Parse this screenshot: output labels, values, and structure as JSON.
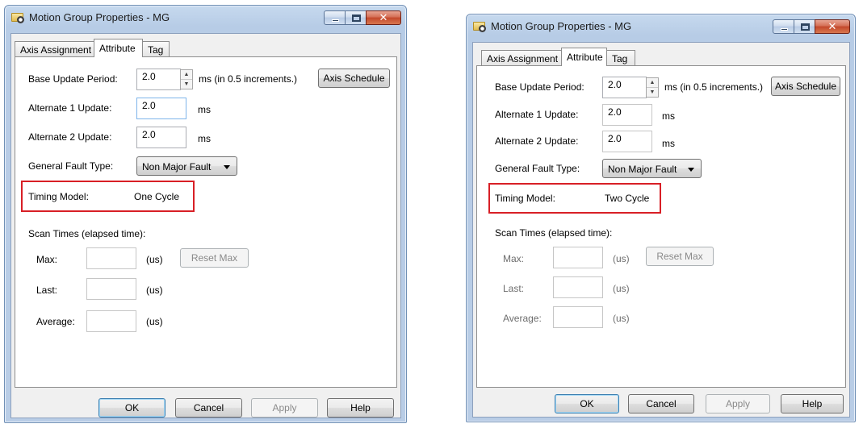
{
  "windows": [
    {
      "title": "Motion Group Properties - MG",
      "tabs": [
        "Axis Assignment",
        "Attribute",
        "Tag"
      ],
      "active_tab": "Attribute",
      "base_update_period": {
        "label": "Base Update Period:",
        "value": "2.0",
        "unit": "ms (in 0.5 increments.)"
      },
      "axis_schedule_button": "Axis Schedule",
      "alternate1": {
        "label": "Alternate 1 Update:",
        "value": "2.0",
        "unit": "ms"
      },
      "alternate2": {
        "label": "Alternate 2 Update:",
        "value": "2.0",
        "unit": "ms"
      },
      "general_fault_type": {
        "label": "General Fault Type:",
        "selected": "Non Major Fault"
      },
      "timing_model": {
        "label": "Timing Model:",
        "value": "One Cycle"
      },
      "scan_times": {
        "heading": "Scan Times (elapsed time):",
        "max": {
          "label": "Max:",
          "value": "",
          "unit": "(us)"
        },
        "last": {
          "label": "Last:",
          "value": "",
          "unit": "(us)"
        },
        "average": {
          "label": "Average:",
          "value": "",
          "unit": "(us)"
        },
        "reset_max": "Reset Max"
      },
      "buttons": {
        "ok": "OK",
        "cancel": "Cancel",
        "apply": "Apply",
        "help": "Help"
      }
    },
    {
      "title": "Motion Group Properties - MG",
      "tabs": [
        "Axis Assignment",
        "Attribute",
        "Tag"
      ],
      "active_tab": "Attribute",
      "base_update_period": {
        "label": "Base Update Period:",
        "value": "2.0",
        "unit": "ms (in 0.5 increments.)"
      },
      "axis_schedule_button": "Axis Schedule",
      "alternate1": {
        "label": "Alternate 1 Update:",
        "value": "2.0",
        "unit": "ms"
      },
      "alternate2": {
        "label": "Alternate 2 Update:",
        "value": "2.0",
        "unit": "ms"
      },
      "general_fault_type": {
        "label": "General Fault Type:",
        "selected": "Non Major Fault"
      },
      "timing_model": {
        "label": "Timing Model:",
        "value": "Two Cycle"
      },
      "scan_times": {
        "heading": "Scan Times (elapsed time):",
        "max": {
          "label": "Max:",
          "value": "",
          "unit": "(us)"
        },
        "last": {
          "label": "Last:",
          "value": "",
          "unit": "(us)"
        },
        "average": {
          "label": "Average:",
          "value": "",
          "unit": "(us)"
        },
        "reset_max": "Reset Max"
      },
      "buttons": {
        "ok": "OK",
        "cancel": "Cancel",
        "apply": "Apply",
        "help": "Help"
      }
    }
  ],
  "colors": {
    "highlight": "#d81f26",
    "titlebar": "#c6d9ee",
    "dialog_bg": "#f0f0f0",
    "close_button": "#c3472b"
  }
}
